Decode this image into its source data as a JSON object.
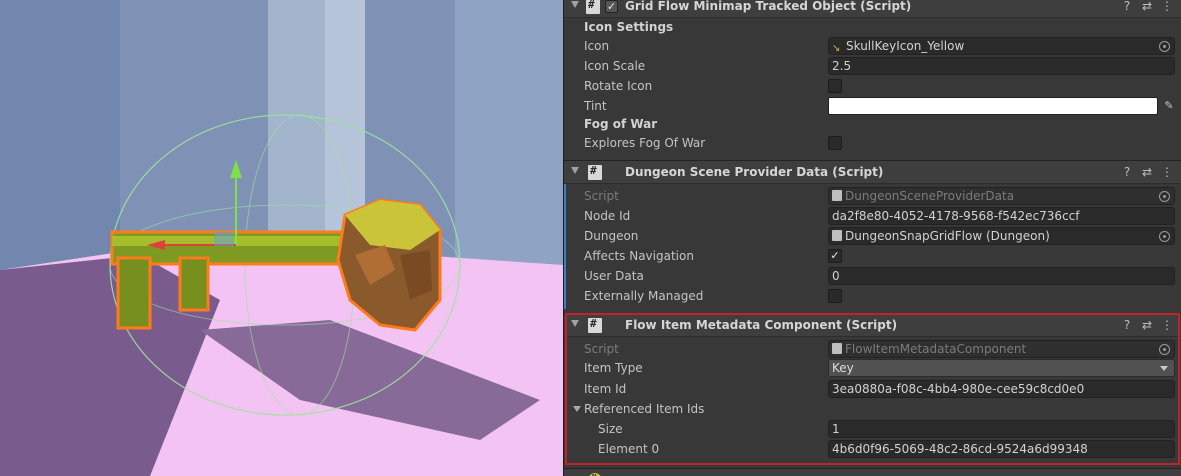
{
  "minimap_component": {
    "title": "Grid Flow Minimap Tracked Object (Script)",
    "enabled_check": "✓",
    "icon_settings_header": "Icon Settings",
    "icon_label": "Icon",
    "icon_value": "SkullKeyIcon_Yellow",
    "icon_scale_label": "Icon Scale",
    "icon_scale_value": "2.5",
    "rotate_icon_label": "Rotate Icon",
    "tint_label": "Tint",
    "tint_color": "#FFFFFF",
    "fog_header": "Fog of War",
    "explores_fog_label": "Explores Fog Of War"
  },
  "provider_component": {
    "title": "Dungeon Scene Provider Data (Script)",
    "script_label": "Script",
    "script_value": "DungeonSceneProviderData",
    "node_id_label": "Node Id",
    "node_id_value": "da2f8e80-4052-4178-9568-f542ec736ccf",
    "dungeon_label": "Dungeon",
    "dungeon_value": "DungeonSnapGridFlow (Dungeon)",
    "affects_nav_label": "Affects Navigation",
    "affects_nav_check": "✓",
    "user_data_label": "User Data",
    "user_data_value": "0",
    "externally_managed_label": "Externally Managed"
  },
  "metadata_component": {
    "title": "Flow Item Metadata Component (Script)",
    "script_label": "Script",
    "script_value": "FlowItemMetadataComponent",
    "item_type_label": "Item Type",
    "item_type_value": "Key",
    "item_id_label": "Item Id",
    "item_id_value": "3ea0880a-f08c-4bb4-980e-cee59c8cd0e0",
    "referenced_label": "Referenced Item Ids",
    "size_label": "Size",
    "size_value": "1",
    "element0_label": "Element 0",
    "element0_value": "4b6d0f96-5069-48c2-86cd-9524a6d99348"
  },
  "header_icons": {
    "help": "?",
    "presets": "⇄",
    "menu": "⋮"
  },
  "colors": {
    "selection_outline": "#C1232A",
    "key_selection": "#FF7A1A",
    "floor": "#F2BFF2"
  }
}
